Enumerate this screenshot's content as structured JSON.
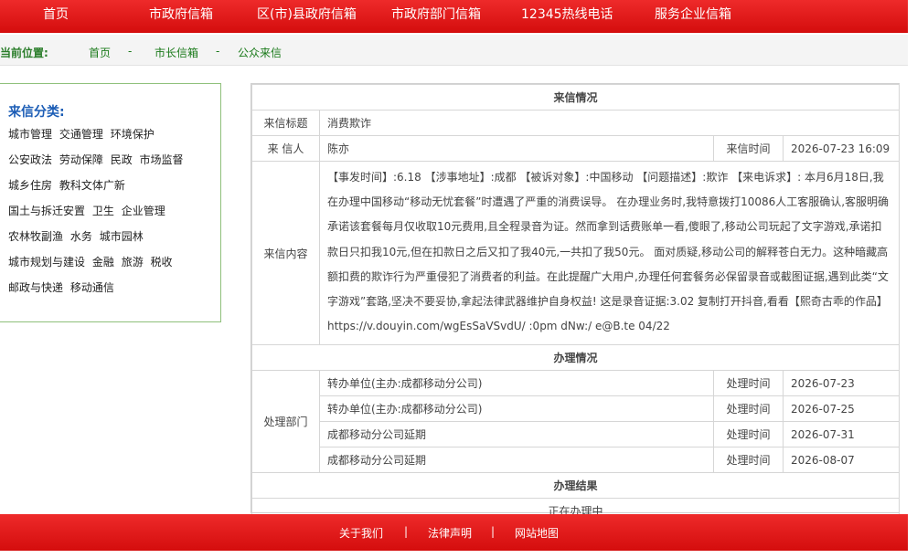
{
  "topnav": {
    "items": [
      "首页",
      "市政府信箱",
      "区(市)县政府信箱",
      "市政府部门信箱",
      "12345热线电话",
      "服务企业信箱"
    ]
  },
  "breadcrumb": {
    "label": "当前位置:",
    "items": [
      "首页",
      "市长信箱",
      "公众来信"
    ],
    "separator": "-"
  },
  "categories": {
    "title": "来信分类:",
    "rows": [
      [
        "城市管理",
        "交通管理",
        "环境保护"
      ],
      [
        "公安政法",
        "劳动保障",
        "民政",
        "市场监督"
      ],
      [
        "城乡住房",
        "教科文体广新"
      ],
      [
        "国土与拆迁安置",
        "卫生",
        "企业管理"
      ],
      [
        "农林牧副渔",
        "水务",
        "城市园林"
      ],
      [
        "城市规划与建设",
        "金融",
        "旅游",
        "税收"
      ],
      [
        "邮政与快递",
        "移动通信"
      ]
    ]
  },
  "letter": {
    "section_title": "来信情况",
    "subject_label": "来信标题",
    "subject": "消费欺诈",
    "sender_label": "来 信人",
    "sender": "陈亦",
    "time_label": "来信时间",
    "time": "2026-07-23 16:09",
    "content_label": "来信内容",
    "content": "【事发时间】:6.18 【涉事地址】:成都 【被诉对象】:中国移动 【问题描述】:欺诈 【来电诉求】: 本月6月18日,我在办理中国移动“移动无忧套餐”时遭遇了严重的消费误导。 在办理业务时,我特意拨打10086人工客服确认,客服明确承诺该套餐每月仅收取10元费用,且全程录音为证。然而拿到话费账单一看,傻眼了,移动公司玩起了文字游戏,承诺扣款日只扣我10元,但在扣款日之后又扣了我40元,一共扣了我50元。 面对质疑,移动公司的解释苍白无力。这种暗藏高额扣费的欺诈行为严重侵犯了消费者的利益。在此提醒广大用户,办理任何套餐务必保留录音或截图证据,遇到此类“文字游戏”套路,坚决不要妥协,拿起法律武器维护自身权益! 这是录音证据:3.02 复制打开抖音,看看【熙奇古乖的作品】 https://v.douyin.com/wgEsSaVSvdU/ :0pm dNw:/ e@B.te 04/22"
  },
  "handling": {
    "section_title": "办理情况",
    "dept_label": "处理部门",
    "time_label": "处理时间",
    "rows": [
      {
        "unit": "转办单位(主办:成都移动分公司)",
        "time": "2026-07-23"
      },
      {
        "unit": "转办单位(主办:成都移动分公司)",
        "time": "2026-07-25"
      },
      {
        "unit": "成都移动分公司延期",
        "time": "2026-07-31"
      },
      {
        "unit": "成都移动分公司延期",
        "time": "2026-08-07"
      }
    ]
  },
  "result": {
    "section_title": "办理结果",
    "status": "正在办理中"
  },
  "footer": {
    "links": [
      "关于我们",
      "法律声明",
      "网站地图"
    ],
    "separator": "|"
  },
  "colors": {
    "brand_red": "#d40d0d",
    "section_blue": "#1f5aa6",
    "crumb_green": "#1a7a1a"
  }
}
